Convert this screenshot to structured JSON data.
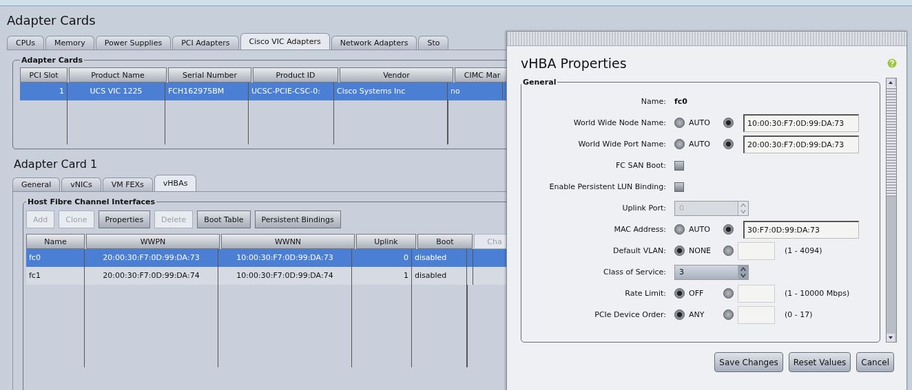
{
  "page_title": "Adapter Cards",
  "tabs": [
    {
      "label": "CPUs",
      "selected": false
    },
    {
      "label": "Memory",
      "selected": false
    },
    {
      "label": "Power Supplies",
      "selected": false
    },
    {
      "label": "PCI Adapters",
      "selected": false
    },
    {
      "label": "Cisco VIC Adapters",
      "selected": true
    },
    {
      "label": "Network Adapters",
      "selected": false
    },
    {
      "label": "Sto",
      "selected": false
    }
  ],
  "adapter_cards": {
    "legend": "Adapter Cards",
    "columns": [
      "PCI Slot",
      "Product Name",
      "Serial Number",
      "Product ID",
      "Vendor",
      "CIMC Mar"
    ],
    "rows": [
      {
        "cells": [
          "1",
          "UCS VIC 1225",
          "FCH162975BM",
          "UCSC-PCIE-CSC-0:",
          "Cisco Systems Inc",
          "no"
        ],
        "selected": true
      }
    ]
  },
  "section_title": "Adapter Card 1",
  "sub_tabs": [
    {
      "label": "General",
      "selected": false
    },
    {
      "label": "vNICs",
      "selected": false
    },
    {
      "label": "VM FEXs",
      "selected": false
    },
    {
      "label": "vHBAs",
      "selected": true
    }
  ],
  "interfaces": {
    "legend": "Host Fibre Channel Interfaces",
    "buttons": [
      {
        "label": "Add",
        "disabled": true
      },
      {
        "label": "Clone",
        "disabled": true
      },
      {
        "label": "Properties",
        "disabled": false
      },
      {
        "label": "Delete",
        "disabled": true
      },
      {
        "label": "Boot Table",
        "disabled": false
      },
      {
        "label": "Persistent Bindings",
        "disabled": false
      }
    ],
    "columns": [
      "Name",
      "WWPN",
      "WWNN",
      "Uplink",
      "Boot",
      "Cha"
    ],
    "rows": [
      {
        "cells": [
          "fc0",
          "20:00:30:F7:0D:99:DA:73",
          "10:00:30:F7:0D:99:DA:73",
          "0",
          "disabled"
        ],
        "selected": true
      },
      {
        "cells": [
          "fc1",
          "20:00:30:F7:0D:99:DA:74",
          "10:00:30:F7:0D:99:DA:74",
          "1",
          "disabled"
        ],
        "selected": false
      }
    ]
  },
  "dialog": {
    "title": "vHBA Properties",
    "legend": "General",
    "fields": [
      {
        "kind": "text",
        "label": "Name:",
        "value": "fc0"
      },
      {
        "kind": "radio_value",
        "label": "World Wide Node Name:",
        "option": "AUTO",
        "auto_selected": false,
        "value": "10:00:30:F7:0D:99:DA:73"
      },
      {
        "kind": "radio_value",
        "label": "World Wide Port Name:",
        "option": "AUTO",
        "auto_selected": false,
        "value": "20:00:30:F7:0D:99:DA:73"
      },
      {
        "kind": "checkbox",
        "label": "FC SAN Boot:",
        "checked": false
      },
      {
        "kind": "checkbox",
        "label": "Enable Persistent LUN Binding:",
        "checked": false
      },
      {
        "kind": "spinner",
        "label": "Uplink Port:",
        "value": "0",
        "disabled": true
      },
      {
        "kind": "radio_value",
        "label": "MAC Address:",
        "option": "AUTO",
        "auto_selected": false,
        "value": "30:F7:0D:99:DA:73"
      },
      {
        "kind": "radio_range",
        "label": "Default VLAN:",
        "option": "NONE",
        "auto_selected": true,
        "range": "(1 - 4094)"
      },
      {
        "kind": "combo",
        "label": "Class of Service:",
        "value": "3"
      },
      {
        "kind": "radio_range",
        "label": "Rate Limit:",
        "option": "OFF",
        "auto_selected": true,
        "range": "(1 - 10000 Mbps)"
      },
      {
        "kind": "radio_range",
        "label": "PCIe Device Order:",
        "option": "ANY",
        "auto_selected": true,
        "range": "(0 - 17)"
      }
    ],
    "buttons": [
      "Save Changes",
      "Reset Values",
      "Cancel"
    ]
  }
}
